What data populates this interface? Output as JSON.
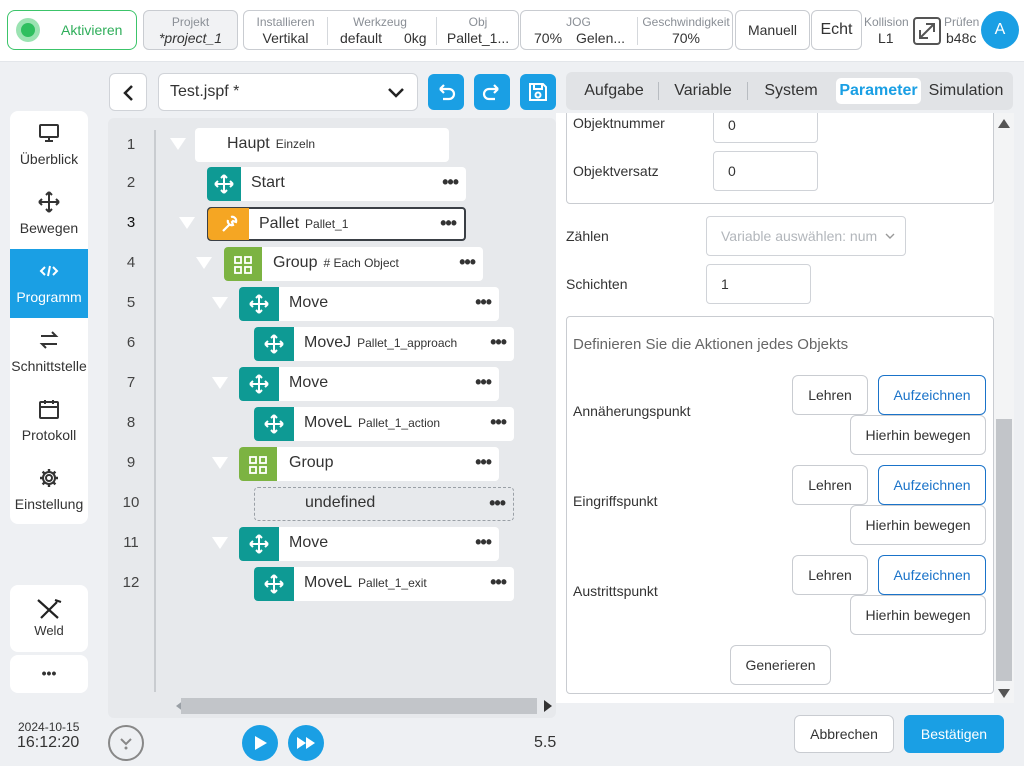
{
  "topbar": {
    "activate_label": "Aktivieren",
    "project": {
      "label": "Projekt",
      "value": "*project_1"
    },
    "install": {
      "label": "Installieren",
      "value": "Vertikal"
    },
    "tool": {
      "label": "Werkzeug",
      "value": "default",
      "value2": "0kg"
    },
    "obj": {
      "label": "Obj",
      "value": "Pallet_1..."
    },
    "jog": {
      "label": "JOG",
      "value": "70%",
      "value2": "Gelen..."
    },
    "speed": {
      "label": "Geschwindigkeit",
      "value": "70%"
    },
    "manual_label": "Manuell",
    "real_label": "Echt",
    "collision": {
      "label": "Kollision",
      "value": "L1"
    },
    "check": {
      "label": "Prüfen",
      "value": "b48c"
    },
    "avatar_letter": "A"
  },
  "sidebar": {
    "items": [
      {
        "label": "Überblick",
        "icon": "monitor-icon"
      },
      {
        "label": "Bewegen",
        "icon": "move-icon"
      },
      {
        "label": "Programm",
        "icon": "code-icon",
        "active": true
      },
      {
        "label": "Schnittstelle",
        "icon": "interface-icon"
      },
      {
        "label": "Protokoll",
        "icon": "calendar-icon"
      },
      {
        "label": "Einstellung",
        "icon": "gear-icon"
      }
    ],
    "weld_label": "Weld",
    "more_label": "•••",
    "date": "2024-10-15",
    "time": "16:12:20"
  },
  "editor": {
    "filename": "Test.jspf *",
    "line_numbers": [
      "1",
      "2",
      "3",
      "4",
      "5",
      "6",
      "7",
      "8",
      "9",
      "10",
      "11",
      "12"
    ],
    "nodes": [
      {
        "title": "Haupt",
        "sub": "Einzeln"
      },
      {
        "title": "Start",
        "sub": ""
      },
      {
        "title": "Pallet",
        "sub": "Pallet_1"
      },
      {
        "title": "Group",
        "sub": "# Each Object"
      },
      {
        "title": "Move",
        "sub": ""
      },
      {
        "title": "MoveJ",
        "sub": "Pallet_1_approach"
      },
      {
        "title": "Move",
        "sub": ""
      },
      {
        "title": "MoveL",
        "sub": "Pallet_1_action"
      },
      {
        "title": "Group",
        "sub": ""
      },
      {
        "title": "undefined",
        "sub": ""
      },
      {
        "title": "Move",
        "sub": ""
      },
      {
        "title": "MoveL",
        "sub": "Pallet_1_exit"
      }
    ],
    "more_dots": "•••",
    "version": "5.5"
  },
  "panel": {
    "tabs": [
      "Aufgabe",
      "Variable",
      "System",
      "Parameter",
      "Simulation"
    ],
    "active_tab": "Parameter",
    "object_number_label": "Objektnummer",
    "object_number_value": "0",
    "object_offset_label": "Objektversatz",
    "object_offset_value": "0",
    "count_label": "Zählen",
    "count_placeholder": "Variable auswählen: num",
    "layers_label": "Schichten",
    "layers_value": "1",
    "actions_heading": "Definieren Sie die Aktionen jedes Objekts",
    "points": [
      {
        "label": "Annäherungspunkt"
      },
      {
        "label": "Eingriffspunkt"
      },
      {
        "label": "Austrittspunkt"
      }
    ],
    "teach_label": "Lehren",
    "record_label": "Aufzeichnen",
    "move_here_label": "Hierhin bewegen",
    "generate_label": "Generieren",
    "cancel_label": "Abbrechen",
    "confirm_label": "Bestätigen"
  },
  "colors": {
    "accent": "#1a9fe4",
    "teal": "#0e9a94",
    "pallet_orange": "#f5a623",
    "group_green": "#7cb342",
    "status_green": "#3cc46a"
  }
}
